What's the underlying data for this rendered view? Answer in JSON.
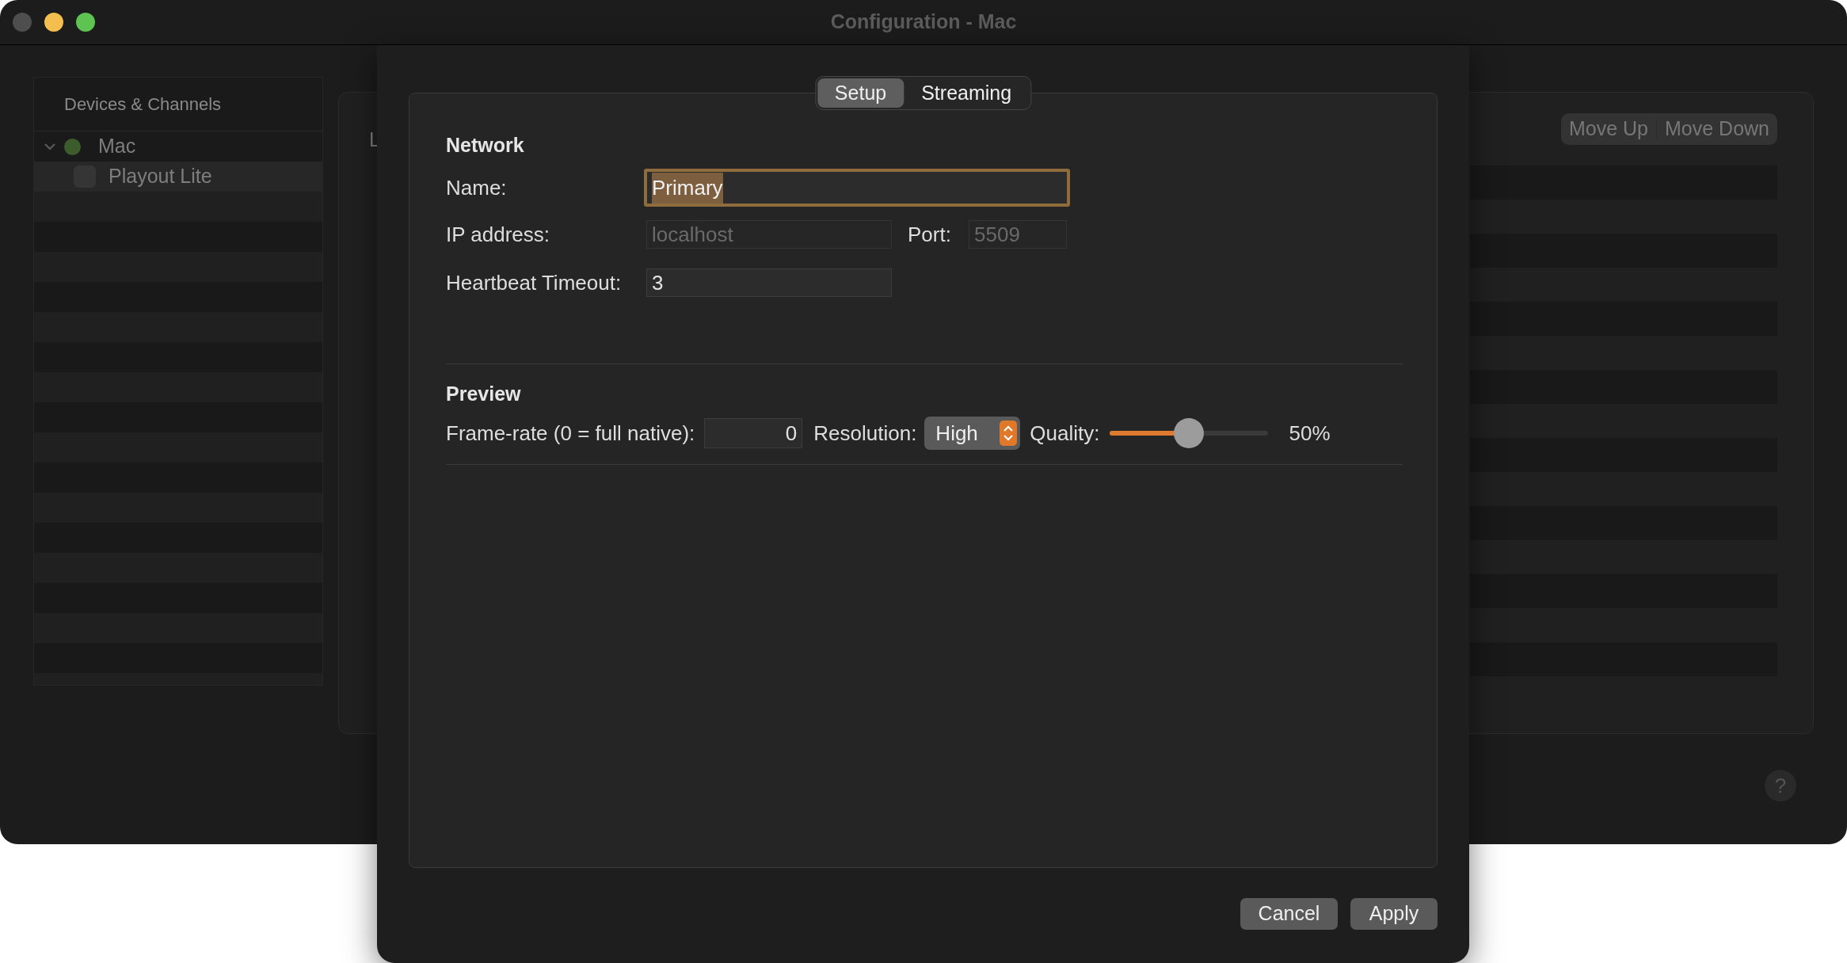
{
  "window": {
    "title": "Configuration - Mac"
  },
  "sidebar": {
    "header": "Devices & Channels",
    "items": [
      {
        "label": "Mac",
        "expanded": true,
        "color": "#3d5c2b",
        "children": [
          {
            "label": "Playout Lite",
            "checked": false,
            "selected": true
          }
        ]
      }
    ]
  },
  "detail": {
    "column_1": "L",
    "buttons": [
      "Move Up",
      "Move Down"
    ],
    "help": "?"
  },
  "dialog": {
    "tabs": [
      {
        "label": "Setup",
        "selected": true
      },
      {
        "label": "Streaming",
        "selected": false
      }
    ],
    "network": {
      "title": "Network",
      "name": {
        "label": "Name:",
        "value": "Primary",
        "focused": true
      },
      "ip_address": {
        "label": "IP address:",
        "value": "localhost",
        "disabled": true
      },
      "port": {
        "label": "Port:",
        "value": "5509",
        "disabled": true
      },
      "heartbeat_timeout": {
        "label": "Heartbeat Timeout:",
        "value": "3",
        "disabled": false
      }
    },
    "preview": {
      "title": "Preview",
      "frame_rate": {
        "label": "Frame-rate (0 = full native):",
        "value": "0"
      },
      "resolution": {
        "label": "Resolution:",
        "value": "High"
      },
      "quality": {
        "label": "Quality:",
        "level": 0.5,
        "reading": "50%"
      }
    },
    "buttons": [
      "Cancel",
      "Apply"
    ]
  }
}
